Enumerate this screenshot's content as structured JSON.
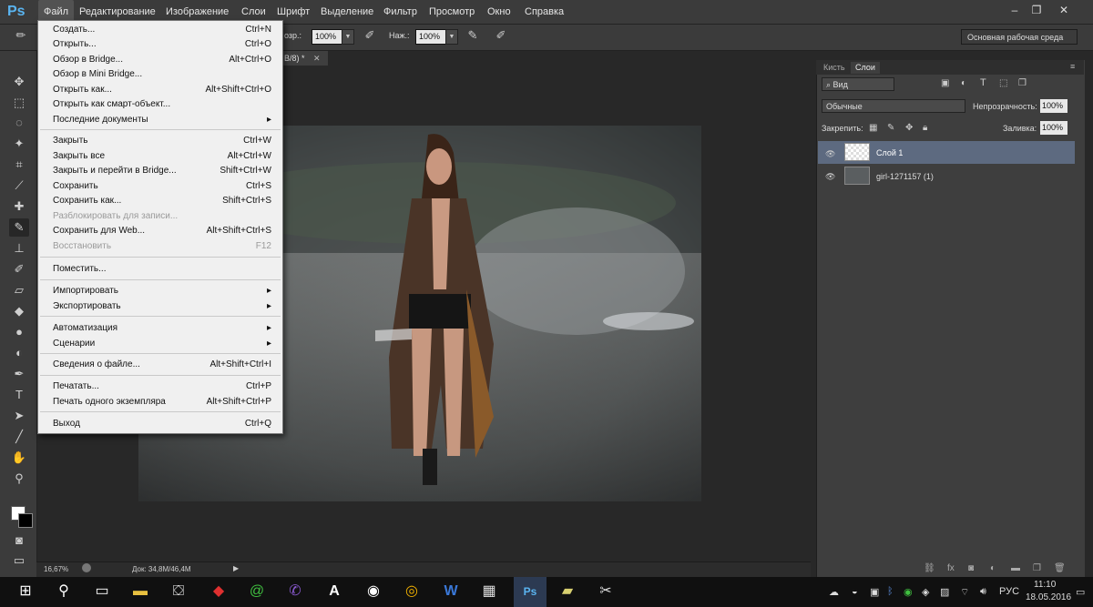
{
  "app": {
    "logo": "Ps"
  },
  "menubar": {
    "items": [
      "Файл",
      "Редактирование",
      "Изображение",
      "Слои",
      "Шрифт",
      "Выделение",
      "Фильтр",
      "Просмотр",
      "Окно",
      "Справка"
    ],
    "window_controls": [
      "–",
      "❐",
      "✕"
    ]
  },
  "options_bar": {
    "fragment_label": "озр.:",
    "opacity_value": "100%",
    "pressure_label": "Наж.:",
    "pressure_value": "100%",
    "workspace": "Основная рабочая среда"
  },
  "document": {
    "tab_title": "B/8) *"
  },
  "status_bar": {
    "zoom": "16,67%",
    "doc_info": "Док: 34,8M/46,4M"
  },
  "file_menu": {
    "items": [
      {
        "label": "Создать...",
        "shortcut": "Ctrl+N"
      },
      {
        "label": "Открыть...",
        "shortcut": "Ctrl+O"
      },
      {
        "label": "Обзор в Bridge...",
        "shortcut": "Alt+Ctrl+O"
      },
      {
        "label": "Обзор в Mini Bridge...",
        "shortcut": ""
      },
      {
        "label": "Открыть как...",
        "shortcut": "Alt+Shift+Ctrl+O"
      },
      {
        "label": "Открыть как смарт-объект...",
        "shortcut": ""
      },
      {
        "label": "Последние документы",
        "shortcut": "▸"
      },
      {
        "label": "Закрыть",
        "shortcut": "Ctrl+W"
      },
      {
        "label": "Закрыть все",
        "shortcut": "Alt+Ctrl+W"
      },
      {
        "label": "Закрыть и перейти в Bridge...",
        "shortcut": "Shift+Ctrl+W"
      },
      {
        "label": "Сохранить",
        "shortcut": "Ctrl+S"
      },
      {
        "label": "Сохранить как...",
        "shortcut": "Shift+Ctrl+S"
      },
      {
        "label": "Разблокировать для записи...",
        "shortcut": ""
      },
      {
        "label": "Сохранить для Web...",
        "shortcut": "Alt+Shift+Ctrl+S"
      },
      {
        "label": "Восстановить",
        "shortcut": "F12"
      },
      {
        "label": "Поместить...",
        "shortcut": ""
      },
      {
        "label": "Импортировать",
        "shortcut": "▸"
      },
      {
        "label": "Экспортировать",
        "shortcut": "▸"
      },
      {
        "label": "Автоматизация",
        "shortcut": "▸"
      },
      {
        "label": "Сценарии",
        "shortcut": "▸"
      },
      {
        "label": "Сведения о файле...",
        "shortcut": "Alt+Shift+Ctrl+I"
      },
      {
        "label": "Печатать...",
        "shortcut": "Ctrl+P"
      },
      {
        "label": "Печать одного экземпляра",
        "shortcut": "Alt+Shift+Ctrl+P"
      },
      {
        "label": "Выход",
        "shortcut": "Ctrl+Q"
      }
    ]
  },
  "layers_panel": {
    "tabs": [
      "Кисть",
      "Слои"
    ],
    "filter_label": "Вид",
    "blend_mode": "Обычные",
    "opacity_label": "Непрозрачность:",
    "opacity_value": "100%",
    "lock_label": "Закрепить:",
    "fill_label": "Заливка:",
    "fill_value": "100%",
    "layers": [
      {
        "name": "Слой 1"
      },
      {
        "name": "girl-1271157 (1)"
      }
    ]
  },
  "taskbar": {
    "time": "11:10",
    "date": "18.05.2016",
    "lang": "РУС"
  }
}
